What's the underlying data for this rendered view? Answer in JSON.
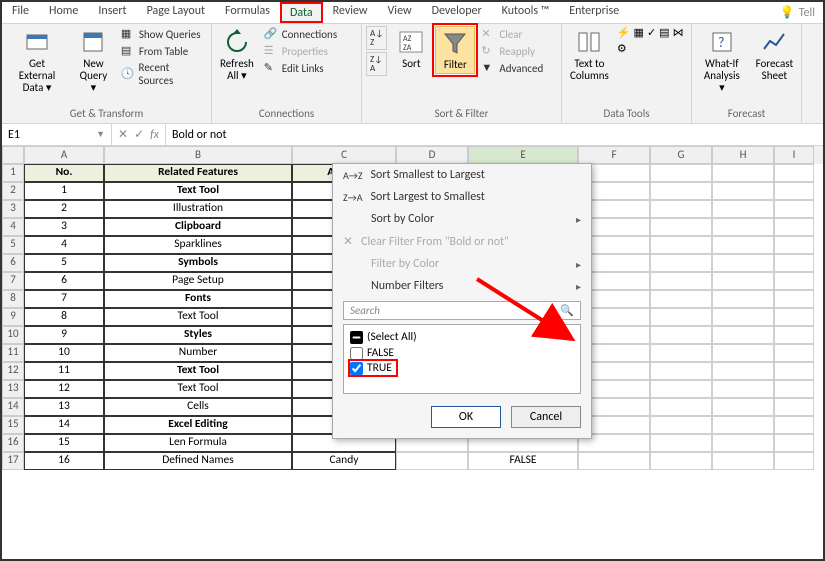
{
  "tabs": [
    "File",
    "Home",
    "Insert",
    "Page Layout",
    "Formulas",
    "Data",
    "Review",
    "View",
    "Developer",
    "Kutools ™",
    "Enterprise"
  ],
  "active_tab": "Data",
  "tellme": "Tell",
  "ribbon": {
    "g1": {
      "a": "Get External\nData ▾",
      "b": "New\nQuery ▾",
      "c1": "Show Queries",
      "c2": "From Table",
      "c3": "Recent Sources",
      "label": "Get & Transform"
    },
    "g2": {
      "a": "Refresh\nAll ▾",
      "c1": "Connections",
      "c2": "Properties",
      "c3": "Edit Links",
      "label": "Connections"
    },
    "g3": {
      "sort": "Sort",
      "filter": "Filter",
      "c1": "Clear",
      "c2": "Reapply",
      "c3": "Advanced",
      "label": "Sort & Filter"
    },
    "g4": {
      "a": "Text to\nColumns",
      "label": "Data Tools"
    },
    "g5": {
      "a": "What-If\nAnalysis ▾",
      "b": "Forecast\nSheet",
      "label": "Forecast"
    }
  },
  "namebox": "E1",
  "formula": "Bold or not",
  "cols": [
    "A",
    "B",
    "C",
    "D",
    "E",
    "F",
    "G",
    "H",
    "I"
  ],
  "headers": {
    "no": "No.",
    "feat": "Related Features",
    "auth": "Author",
    "bold": "Bold or not"
  },
  "rows": [
    {
      "n": "1",
      "f": "Text Tool",
      "b": true
    },
    {
      "n": "2",
      "f": "Illustration",
      "b": false
    },
    {
      "n": "3",
      "f": "Clipboard",
      "b": true
    },
    {
      "n": "4",
      "f": "Sparklines",
      "b": false
    },
    {
      "n": "5",
      "f": "Symbols",
      "b": true
    },
    {
      "n": "6",
      "f": "Page Setup",
      "b": false
    },
    {
      "n": "7",
      "f": "Fonts",
      "b": true
    },
    {
      "n": "8",
      "f": "Text Tool",
      "b": false
    },
    {
      "n": "9",
      "f": "Styles",
      "b": true
    },
    {
      "n": "10",
      "f": "Number",
      "b": false
    },
    {
      "n": "11",
      "f": "Text Tool",
      "b": true
    },
    {
      "n": "12",
      "f": "Text Tool",
      "b": false
    },
    {
      "n": "13",
      "f": "Cells",
      "b": false
    },
    {
      "n": "14",
      "f": "Excel Editing",
      "b": true
    },
    {
      "n": "15",
      "f": "Len Formula",
      "b": false
    },
    {
      "n": "16",
      "f": "Defined Names",
      "b": false,
      "auth": "Candy",
      "e": "FALSE"
    }
  ],
  "menu": {
    "s1": "Sort Smallest to Largest",
    "s2": "Sort Largest to Smallest",
    "s3": "Sort by Color",
    "s4": "Clear Filter From \"Bold or not\"",
    "s5": "Filter by Color",
    "s6": "Number Filters",
    "search": "Search",
    "all": "(Select All)",
    "false": "FALSE",
    "true": "TRUE",
    "ok": "OK",
    "cancel": "Cancel"
  }
}
